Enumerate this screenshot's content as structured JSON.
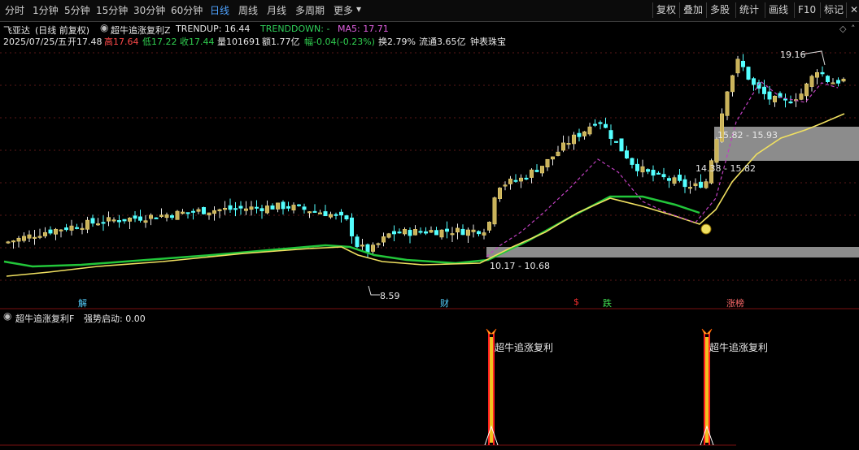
{
  "toolbar": {
    "periods": [
      "分时",
      "1分钟",
      "5分钟",
      "15分钟",
      "30分钟",
      "60分钟",
      "日线",
      "周线",
      "月线",
      "多周期",
      "更多"
    ],
    "active_period": "日线",
    "right_buttons": [
      "复权",
      "叠加",
      "多股",
      "统计",
      "画线",
      "F10",
      "标记"
    ]
  },
  "header": {
    "stock_name": "飞亚达",
    "period_info": "(日线 前复权)",
    "indicator_name": "超牛追涨复利Z",
    "trendup_label": "TRENDUP: 16.44",
    "trenddown_label": "TRENDDOWN: -",
    "ma5_label": "MA5: 17.71"
  },
  "quote": {
    "date": "2025/07/25/五",
    "open": "开17.48",
    "high": "高17.64",
    "low": "低17.22",
    "close": "收17.44",
    "volume": "量101691",
    "amount": "额1.77亿",
    "change": "幅-0.04(-0.23%)",
    "turnover": "换2.79%",
    "float": "流通3.65亿",
    "sector": "钟表珠宝"
  },
  "annotations": {
    "price_high_label": "19.16",
    "price_low_label": "8.59",
    "zone_top_label": "15.82 - 15.93",
    "zone_mid_label": "14.38 - 15.82",
    "zone_low_label": "10.17 - 10.68",
    "event_tags": [
      "解",
      "财",
      "$",
      "跌",
      "涨榜"
    ]
  },
  "sub_panel": {
    "title": "超牛追涨复利F",
    "value_label": "强势启动: 0.00",
    "signal_labels": [
      "超牛追涨复利",
      "超牛追涨复利"
    ]
  },
  "colors": {
    "up": "#ff3c3c",
    "down": "#54ffff",
    "ma_green": "#22c63a",
    "ma_yellow": "#f0e060",
    "trend_magenta": "#c040c0",
    "zone_gray": "#8c8c8c",
    "active_blue": "#4fa3ff"
  }
}
